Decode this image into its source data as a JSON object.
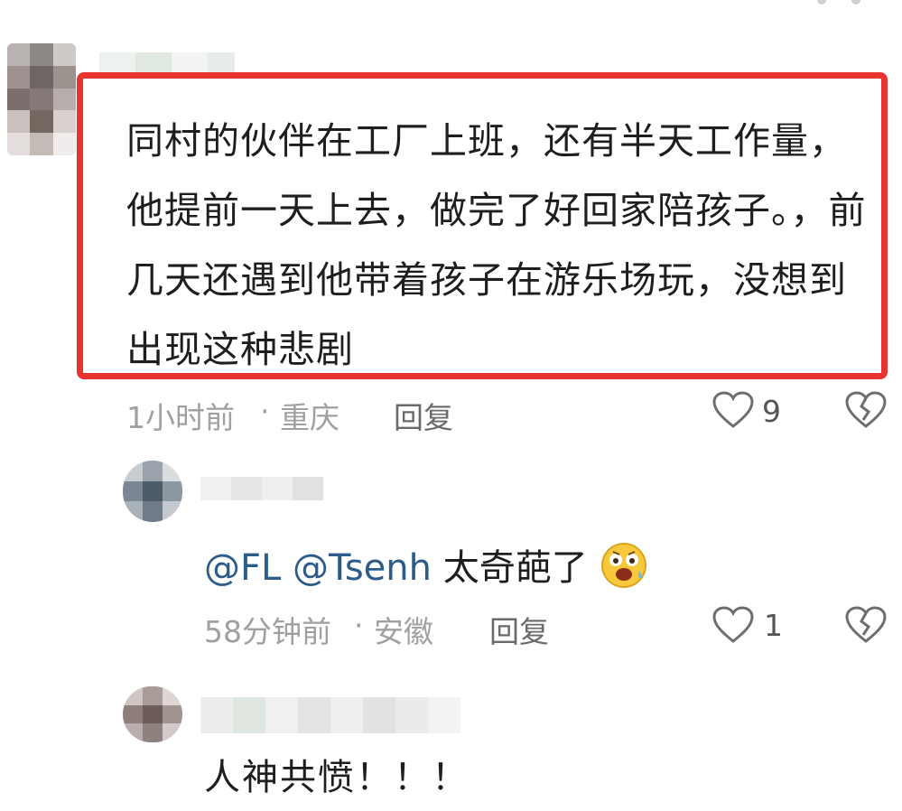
{
  "comment": {
    "text": "同村的伙伴在工厂上班，还有半天工作量，他提前一天上去，做完了好回家陪孩子。，前几天还遇到他带着孩子在游乐场玩，没想到出现这种悲剧",
    "time": "1小时前",
    "location": "重庆",
    "reply_label": "回复",
    "likes": "9"
  },
  "replies": [
    {
      "mention_1": "@FL",
      "mention_2": "@Tsenh",
      "text": "太奇葩了",
      "time": "58分钟前",
      "location": "安徽",
      "reply_label": "回复",
      "likes": "1"
    },
    {
      "text": "人神共愤！！！"
    }
  ],
  "separator": "·",
  "colors": {
    "highlight": "#e8332f",
    "mention": "#2c5c8a",
    "meta": "#a0a0a0"
  },
  "icons": [
    "heart-outline-icon",
    "broken-heart-icon",
    "scared-face-emoji"
  ]
}
